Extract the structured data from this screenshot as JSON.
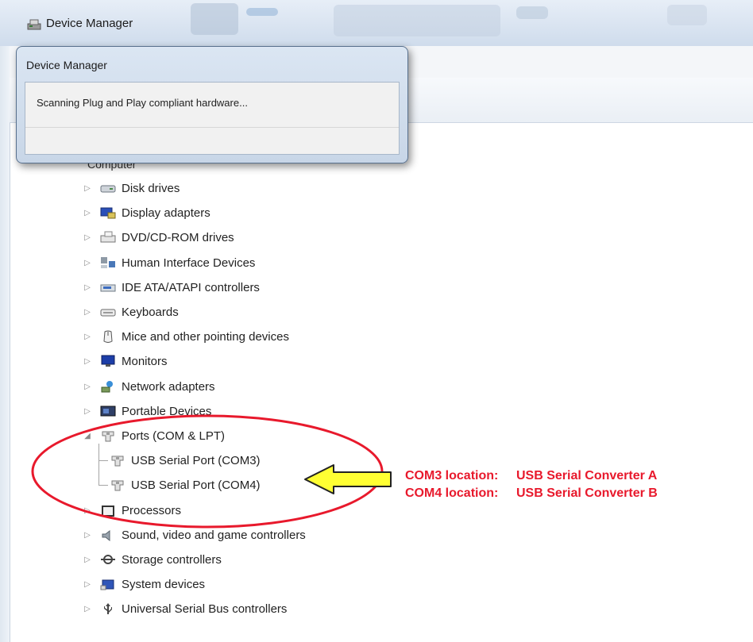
{
  "window": {
    "title": "Device Manager"
  },
  "dialog": {
    "title": "Device Manager",
    "message": "Scanning Plug and Play compliant hardware..."
  },
  "tree": {
    "clipped_label": "Computer",
    "items": [
      {
        "label": "Disk drives",
        "icon": "disk-drive-icon"
      },
      {
        "label": "Display adapters",
        "icon": "display-adapter-icon"
      },
      {
        "label": "DVD/CD-ROM drives",
        "icon": "dvd-drive-icon"
      },
      {
        "label": "Human Interface Devices",
        "icon": "hid-icon"
      },
      {
        "label": "IDE ATA/ATAPI controllers",
        "icon": "ide-controller-icon"
      },
      {
        "label": "Keyboards",
        "icon": "keyboard-icon"
      },
      {
        "label": "Mice and other pointing devices",
        "icon": "mouse-icon"
      },
      {
        "label": "Monitors",
        "icon": "monitor-icon"
      },
      {
        "label": "Network adapters",
        "icon": "network-adapter-icon"
      },
      {
        "label": "Portable Devices",
        "icon": "portable-device-icon"
      },
      {
        "label": "Ports (COM & LPT)",
        "icon": "port-icon",
        "expanded": true
      },
      {
        "label": "USB Serial Port (COM3)",
        "icon": "port-icon",
        "child": true
      },
      {
        "label": "USB Serial Port (COM4)",
        "icon": "port-icon",
        "child": true
      },
      {
        "label": "Processors",
        "icon": "processor-icon"
      },
      {
        "label": "Sound, video and game controllers",
        "icon": "sound-icon"
      },
      {
        "label": "Storage controllers",
        "icon": "storage-controller-icon"
      },
      {
        "label": "System devices",
        "icon": "system-devices-icon"
      },
      {
        "label": "Universal Serial Bus controllers",
        "icon": "usb-controller-icon"
      }
    ]
  },
  "annotation": {
    "color": "#e8192c",
    "com3_key": "COM3 location:",
    "com3_value": "USB Serial Converter A",
    "com4_key": "COM4 location:",
    "com4_value": "USB Serial Converter B"
  }
}
